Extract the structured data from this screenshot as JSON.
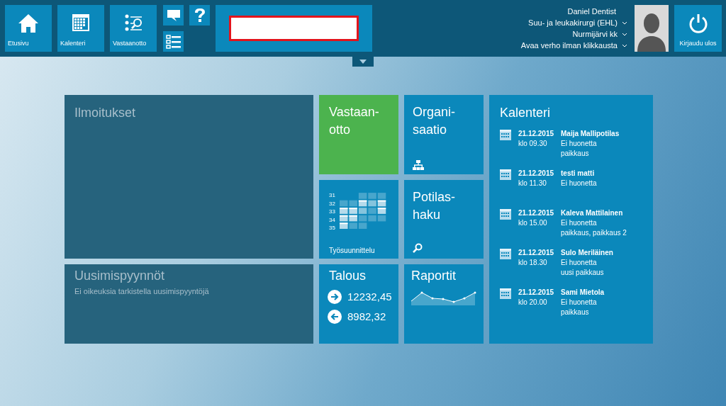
{
  "nav": {
    "buttons": [
      {
        "kind": "home",
        "label": "Etusivu"
      },
      {
        "kind": "calendar",
        "label": "Kalenteri"
      },
      {
        "kind": "reception",
        "label": "Vastaanotto"
      }
    ],
    "small_buttons": [
      {
        "kind": "chat"
      },
      {
        "kind": "help"
      },
      {
        "kind": "list"
      }
    ]
  },
  "search": {
    "invalid": true
  },
  "user": {
    "name": "Daniel Dentist",
    "menus": [
      "Suu- ja leukakirurgi (EHL)",
      "Nurmijärvi kk",
      "Avaa verho ilman klikkausta"
    ]
  },
  "logout": {
    "label": "Kirjaudu ulos"
  },
  "notices": {
    "title": "Ilmoitukset"
  },
  "renewals": {
    "title": "Uusimispyynnöt",
    "message": "Ei oikeuksia tarkistella uusimispyyntöjä"
  },
  "reception": {
    "title_lines": [
      "Vastaan-",
      "otto"
    ]
  },
  "organisation": {
    "title_lines": [
      "Organi-",
      "saatio"
    ]
  },
  "work_planning": {
    "weeks": [
      "31",
      "32",
      "33",
      "34",
      "35"
    ],
    "label": "Työsuunnittelu"
  },
  "patient_search": {
    "title_lines": [
      "Potilas-",
      "haku"
    ]
  },
  "finance": {
    "title": "Talous",
    "entries": [
      {
        "kind": "incoming",
        "amount": "12232,45"
      },
      {
        "kind": "outgoing",
        "amount": "8982,32"
      }
    ]
  },
  "reports": {
    "title": "Raportit"
  },
  "calendar": {
    "title": "Kalenteri",
    "appointments": [
      {
        "date": "21.12.2015",
        "time": "klo 09.30",
        "patient": "Maija Mallipotilas",
        "room": "Ei huonetta",
        "procedure": "paikkaus"
      },
      {
        "date": "21.12.2015",
        "time": "klo 11.30",
        "patient": "testi matti",
        "room": "Ei huonetta"
      },
      {
        "date": "21.12.2015",
        "time": "klo 15.00",
        "patient": "Kaleva Mattilainen",
        "room": "Ei huonetta",
        "procedure": "paikkaus, paikkaus 2"
      },
      {
        "date": "21.12.2015",
        "time": "klo 18.30",
        "patient": "Sulo Meriläinen",
        "room": "Ei huonetta",
        "procedure": "uusi paikkaus"
      },
      {
        "date": "21.12.2015",
        "time": "klo 20.00",
        "patient": "Sami Mietola",
        "room": "Ei huonetta",
        "procedure": "paikkaus"
      }
    ]
  }
}
